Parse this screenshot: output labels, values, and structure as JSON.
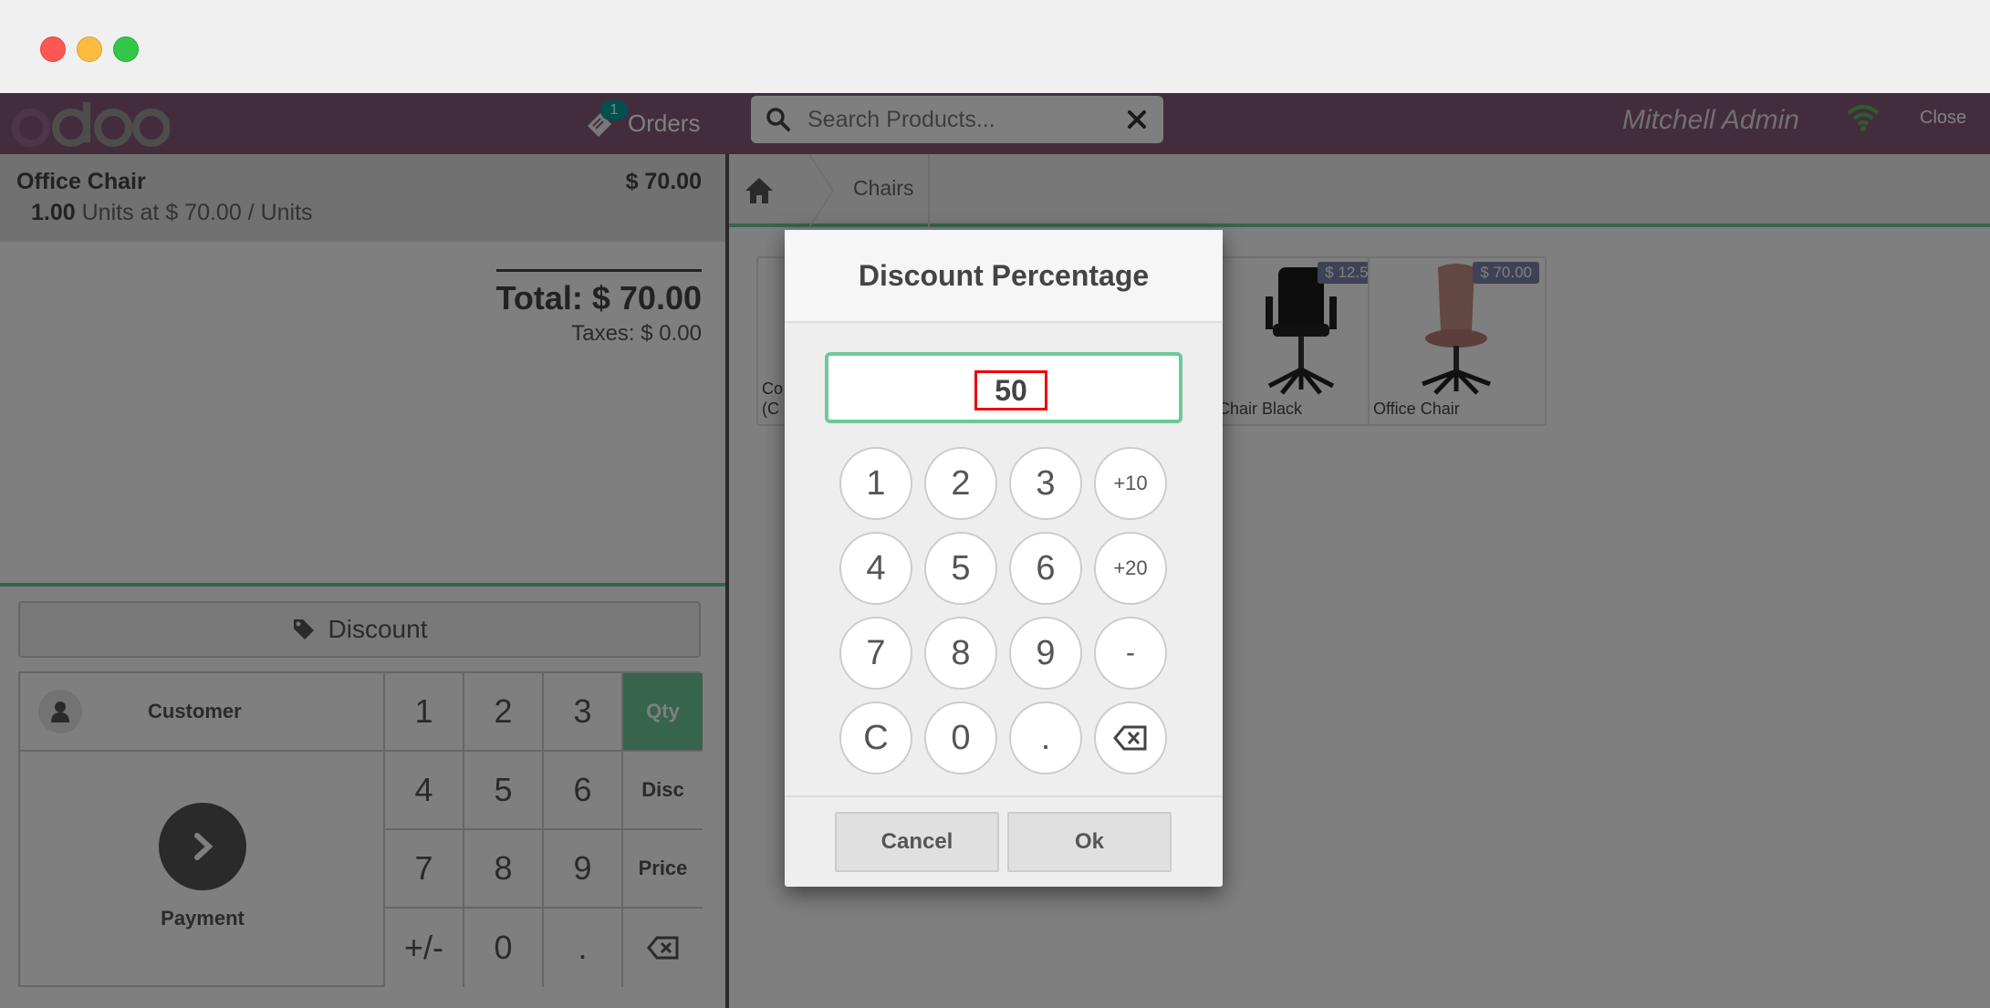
{
  "header": {
    "orders_label": "Orders",
    "orders_count": "1",
    "search_placeholder": "Search Products...",
    "user_name": "Mitchell Admin",
    "close_label": "Close"
  },
  "order": {
    "line": {
      "product_name": "Office Chair",
      "price": "$ 70.00",
      "quantity": "1.00",
      "unit_info": "Units at $ 70.00 / Units"
    },
    "total": "Total: $ 70.00",
    "taxes": "Taxes: $ 0.00"
  },
  "actions": {
    "discount_label": "Discount",
    "customer_label": "Customer",
    "payment_label": "Payment"
  },
  "numpad": {
    "keys": [
      "1",
      "2",
      "3",
      "4",
      "5",
      "6",
      "7",
      "8",
      "9",
      "+/-",
      "0",
      "."
    ],
    "modes": [
      "Qty",
      "Disc",
      "Price"
    ],
    "active_mode": "Qty"
  },
  "breadcrumbs": {
    "category": "Chairs"
  },
  "products": [
    {
      "name": "Co\n(C",
      "price": ""
    },
    {
      "name": "Chair Black",
      "price": "$ 12.50"
    },
    {
      "name": "Office Chair",
      "price": "$ 70.00"
    }
  ],
  "popup": {
    "title": "Discount Percentage",
    "value": "50",
    "keys": [
      "1",
      "2",
      "3",
      "+10",
      "4",
      "5",
      "6",
      "+20",
      "7",
      "8",
      "9",
      "-",
      "C",
      "0",
      "."
    ],
    "cancel_label": "Cancel",
    "ok_label": "Ok"
  },
  "colors": {
    "brand": "#875a7b",
    "accent": "#6ec89b",
    "price_badge": "#7f82ac"
  }
}
